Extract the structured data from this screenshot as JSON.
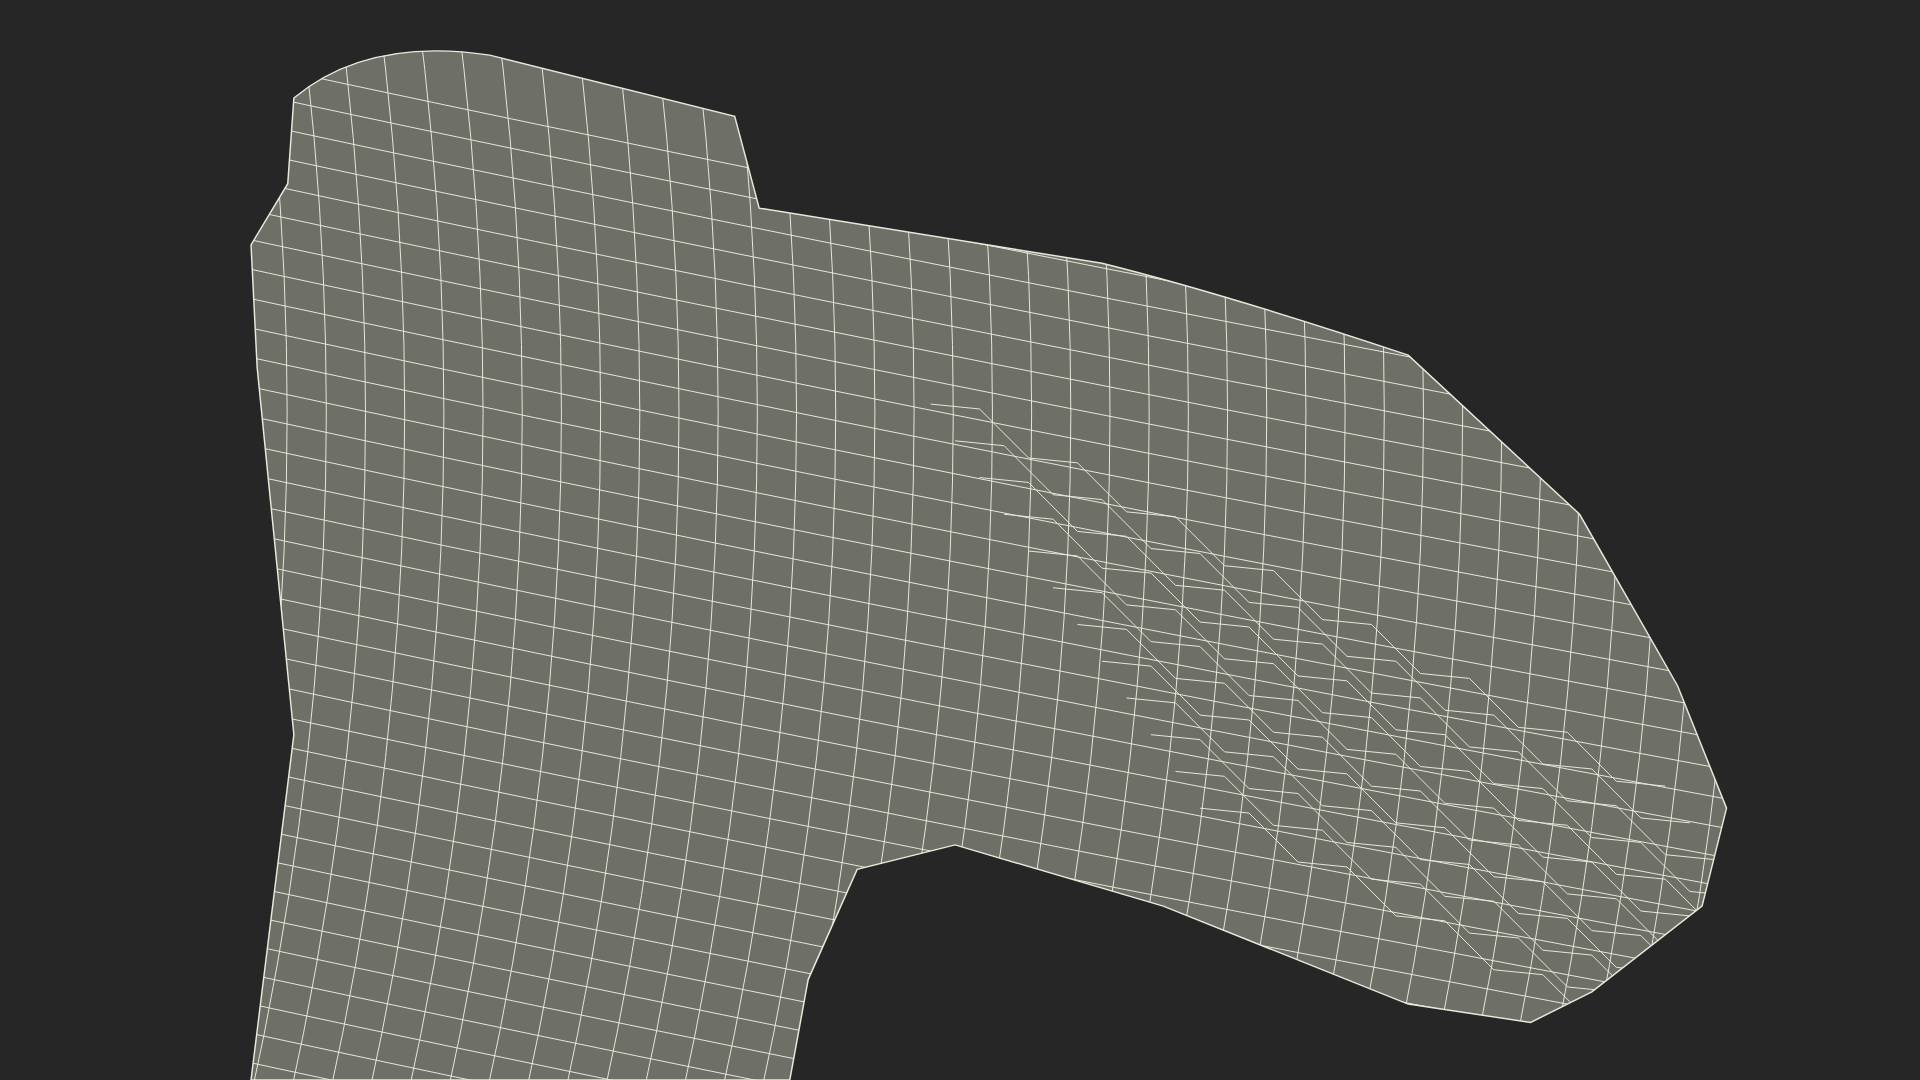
{
  "render": {
    "kind": "wireframe"
  }
}
